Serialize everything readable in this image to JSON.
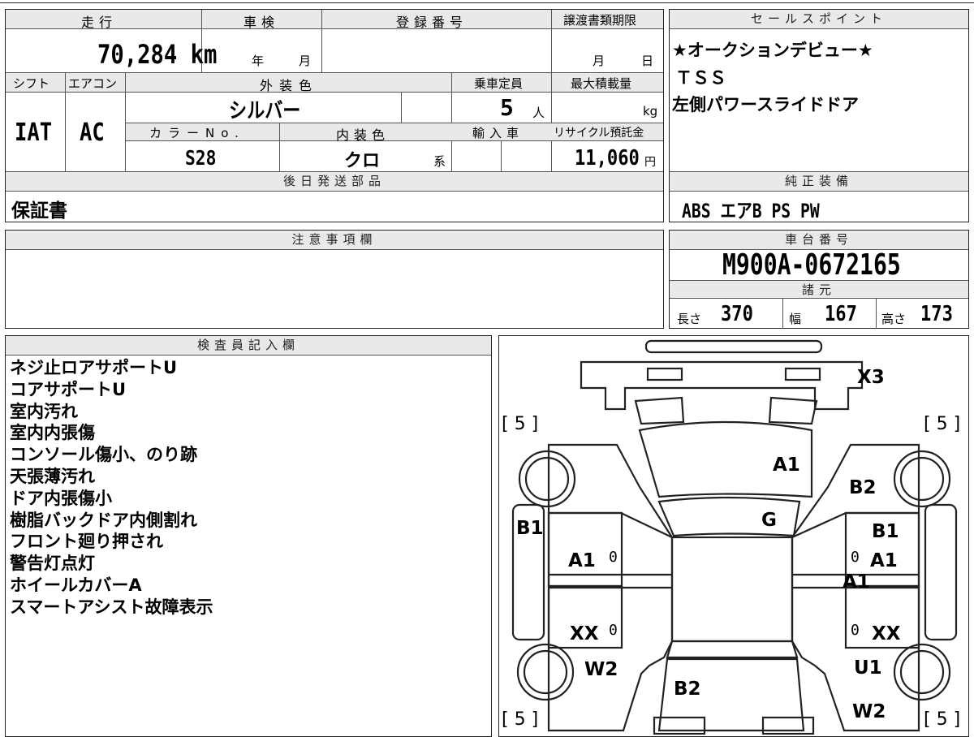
{
  "vehicle": {
    "mileage_label": "走行",
    "mileage": "70,284",
    "mileage_unit": "km",
    "shaken_label": "車検",
    "shaken_year_unit": "年",
    "shaken_month_unit": "月",
    "reg_no_label": "登録番号",
    "transfer_label": "譲渡書類期限",
    "transfer_month_unit": "月",
    "transfer_day_unit": "日",
    "shift_label": "シフト",
    "shift": "IAT",
    "ac_label": "エアコン",
    "ac": "AC",
    "exterior_label": "外装色",
    "exterior": "シルバー",
    "capacity_label": "乗車定員",
    "capacity": "5",
    "capacity_unit": "人",
    "max_load_label": "最大積載量",
    "max_load_unit": "kg",
    "color_no_label": "カラーNo.",
    "color_no": "S28",
    "interior_label": "内装色",
    "interior": "クロ",
    "interior_unit": "系",
    "import_label": "輸入車",
    "recycle_label": "リサイクル預託金",
    "recycle": "11,060",
    "recycle_unit": "円"
  },
  "later_parts": {
    "label": "後日発送部品",
    "value": "保証書"
  },
  "notice": {
    "label": "注意事項欄"
  },
  "sales_points": {
    "label": "セールスポイント",
    "lines": [
      "★オークションデビュー★",
      "ＴＳＳ",
      "左側パワースライドドア"
    ]
  },
  "equipment": {
    "label": "純正装備",
    "value": "ABS エアB PS PW"
  },
  "chassis": {
    "label": "車台番号",
    "value": "M900A-0672165"
  },
  "specs": {
    "label": "諸元",
    "length_label": "長さ",
    "length": "370",
    "width_label": "幅",
    "width": "167",
    "height_label": "高さ",
    "height": "173"
  },
  "inspector": {
    "label": "検査員記入欄",
    "notes": [
      "ネジ止ロアサポートU",
      "コアサポートU",
      "室内汚れ",
      "室内内張傷",
      "コンソール傷小、のり跡",
      "天張薄汚れ",
      "ドア内張傷小",
      "樹脂バックドア内側割れ",
      "フロント廻り押され",
      "警告灯点灯",
      "ホイールカバーA",
      "スマートアシスト故障表示"
    ]
  },
  "diagram": {
    "tire_fl": "[ 5 ]",
    "tire_fr": "[ 5 ]",
    "tire_rl": "[ 5 ]",
    "tire_rr": "[ 5 ]",
    "marks": {
      "bumper": "X3",
      "hood": "A1",
      "fender_r": "B2",
      "windshield": "G",
      "fender_l": "B1",
      "front_door_l": "A1",
      "front_door_r_top": "B1",
      "front_door_r": "A1",
      "front_door_r2": "A1",
      "rear_door_l": "XX",
      "rear_door_r": "XX",
      "rear_fender_l": "W2",
      "rear_fender_r": "U1",
      "rear": "B2",
      "rear_corner_r": "W2",
      "zero1": "0",
      "zero2": "0",
      "zero3": "0",
      "zero4": "0"
    }
  }
}
